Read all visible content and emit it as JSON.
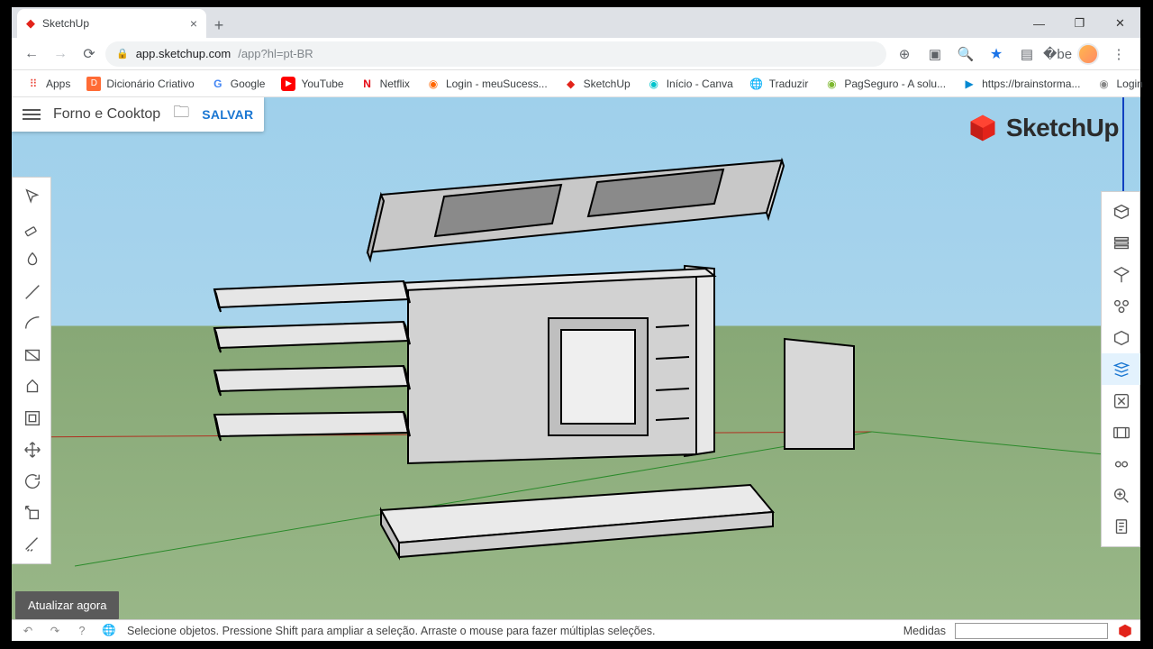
{
  "browser": {
    "tab_title": "SketchUp",
    "url_host": "app.sketchup.com",
    "url_path": "/app?hl=pt-BR",
    "bookmarks": [
      {
        "label": "Apps"
      },
      {
        "label": "Dicionário Criativo"
      },
      {
        "label": "Google"
      },
      {
        "label": "YouTube"
      },
      {
        "label": "Netflix"
      },
      {
        "label": "Login - meuSucess..."
      },
      {
        "label": "SketchUp"
      },
      {
        "label": "Início - Canva"
      },
      {
        "label": "Traduzir"
      },
      {
        "label": "PagSeguro - A solu..."
      },
      {
        "label": "https://brainstorma..."
      },
      {
        "label": "Login"
      }
    ]
  },
  "app": {
    "file_name": "Forno e Cooktop",
    "save_label": "SALVAR",
    "brand": "SketchUp",
    "update_banner": "Atualizar agora",
    "status_hint": "Selecione objetos. Pressione Shift para ampliar a seleção. Arraste o mouse para fazer múltiplas seleções.",
    "measurement_label": "Medidas",
    "measurement_value": ""
  }
}
